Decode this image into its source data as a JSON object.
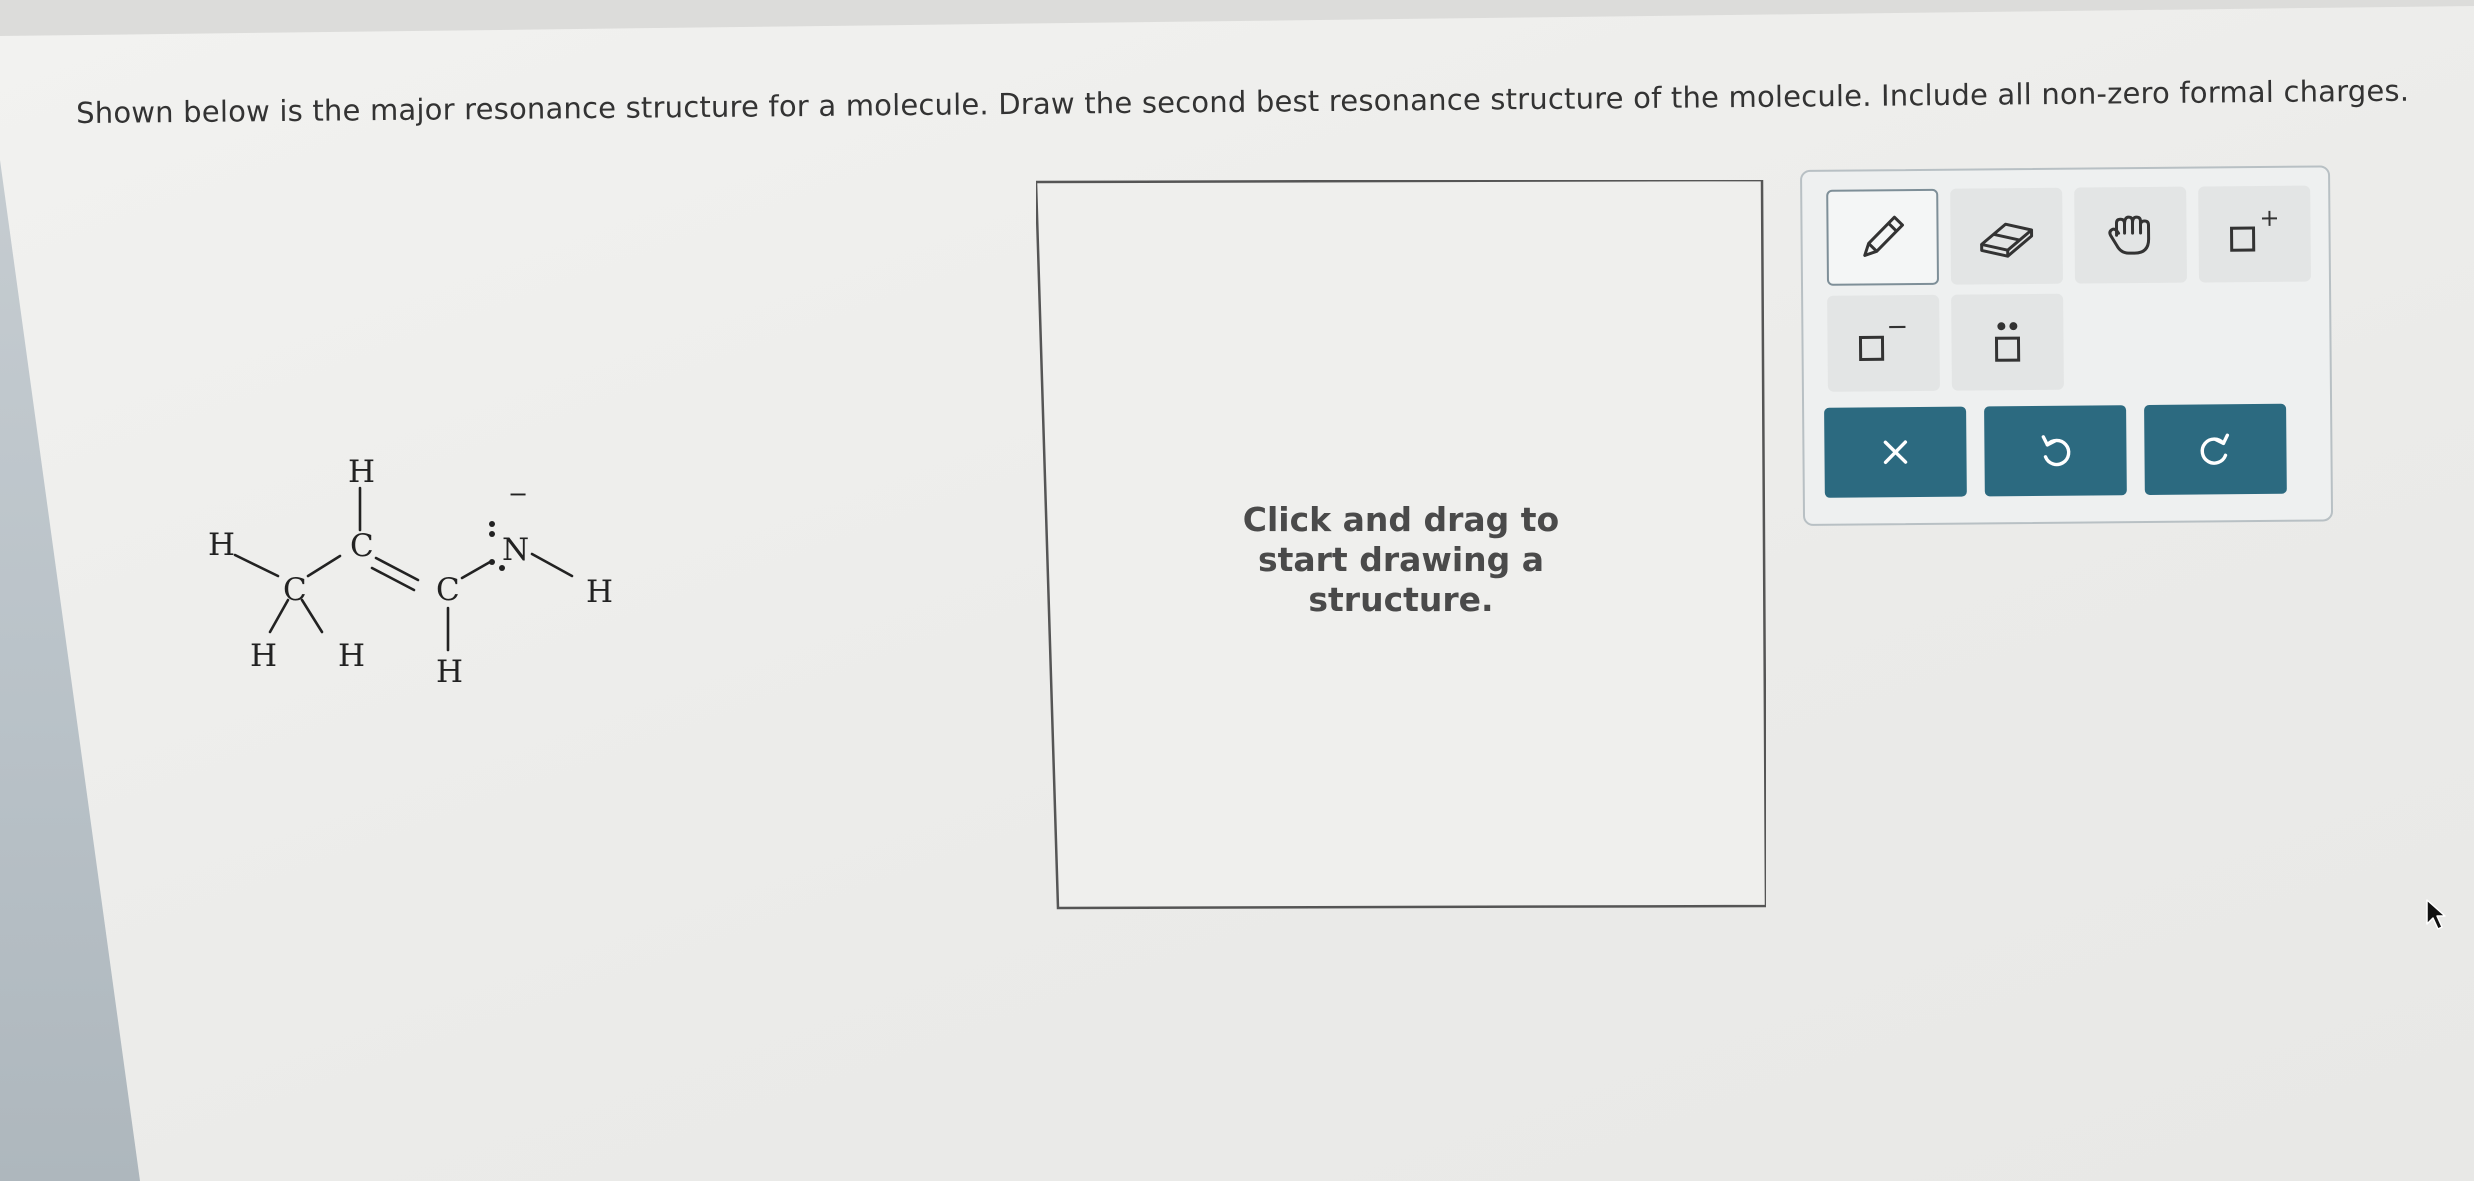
{
  "question": {
    "text": "Shown below is the major resonance structure for a molecule. Draw the second best resonance structure of the molecule. Include all non-zero formal charges."
  },
  "molecule": {
    "atoms": {
      "h_left": "H",
      "c1": "C",
      "h_c1_a": "H",
      "h_c1_b": "H",
      "h_top": "H",
      "c2": "C",
      "c3": "C",
      "h_c3": "H",
      "n": "N",
      "h_n": "H"
    },
    "n_charge": "−"
  },
  "canvas": {
    "hint": "Click and drag to start drawing a structure."
  },
  "toolbar": {
    "tools": [
      {
        "name": "pencil",
        "icon": "pencil-icon"
      },
      {
        "name": "eraser",
        "icon": "eraser-icon"
      },
      {
        "name": "hand",
        "icon": "hand-icon"
      },
      {
        "name": "positive-charge",
        "icon": "positive-charge-icon"
      },
      {
        "name": "negative-charge",
        "icon": "negative-charge-icon"
      },
      {
        "name": "lone-pair",
        "icon": "lone-pair-icon"
      }
    ],
    "actions": [
      {
        "name": "clear",
        "icon": "close-icon"
      },
      {
        "name": "undo",
        "icon": "undo-icon"
      },
      {
        "name": "redo",
        "icon": "redo-icon"
      }
    ],
    "charge_plus": "+",
    "charge_minus": "−"
  },
  "colors": {
    "action_button": "#2c6a80",
    "panel_border": "#b8c0c4",
    "canvas_border": "#555555"
  }
}
